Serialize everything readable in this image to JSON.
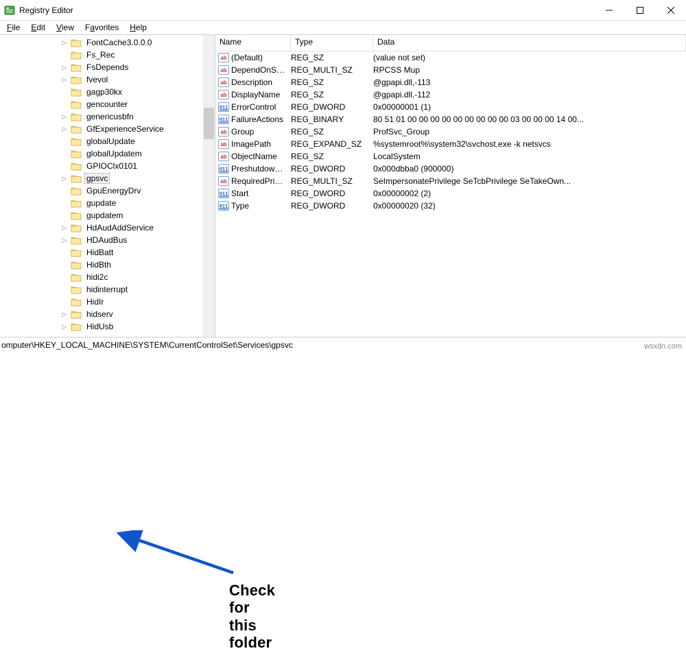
{
  "window": {
    "title": "Registry Editor"
  },
  "menu": {
    "items": [
      "File",
      "Edit",
      "View",
      "Favorites",
      "Help"
    ]
  },
  "tree": {
    "items": [
      {
        "label": "FontCache3.0.0.0",
        "exp": ">"
      },
      {
        "label": "Fs_Rec",
        "exp": ""
      },
      {
        "label": "FsDepends",
        "exp": ">"
      },
      {
        "label": "fvevol",
        "exp": ">"
      },
      {
        "label": "gagp30kx",
        "exp": ""
      },
      {
        "label": "gencounter",
        "exp": ""
      },
      {
        "label": "genericusbfn",
        "exp": ">"
      },
      {
        "label": "GfExperienceService",
        "exp": ">"
      },
      {
        "label": "globalUpdate",
        "exp": ""
      },
      {
        "label": "globalUpdatem",
        "exp": ""
      },
      {
        "label": "GPIOClx0101",
        "exp": ""
      },
      {
        "label": "gpsvc",
        "exp": ">",
        "selected": true
      },
      {
        "label": "GpuEnergyDrv",
        "exp": ""
      },
      {
        "label": "gupdate",
        "exp": ""
      },
      {
        "label": "gupdatem",
        "exp": ""
      },
      {
        "label": "HdAudAddService",
        "exp": ">"
      },
      {
        "label": "HDAudBus",
        "exp": ">"
      },
      {
        "label": "HidBatt",
        "exp": ""
      },
      {
        "label": "HidBth",
        "exp": ""
      },
      {
        "label": "hidi2c",
        "exp": ""
      },
      {
        "label": "hidinterrupt",
        "exp": ""
      },
      {
        "label": "HidIr",
        "exp": ""
      },
      {
        "label": "hidserv",
        "exp": ">"
      },
      {
        "label": "HidUsb",
        "exp": ">"
      }
    ]
  },
  "list": {
    "headers": {
      "name": "Name",
      "type": "Type",
      "data": "Data"
    },
    "rows": [
      {
        "icon": "ab",
        "name": "(Default)",
        "type": "REG_SZ",
        "data": "(value not set)"
      },
      {
        "icon": "ab",
        "name": "DependOnService",
        "type": "REG_MULTI_SZ",
        "data": "RPCSS Mup"
      },
      {
        "icon": "ab",
        "name": "Description",
        "type": "REG_SZ",
        "data": "@gpapi.dll,-113"
      },
      {
        "icon": "ab",
        "name": "DisplayName",
        "type": "REG_SZ",
        "data": "@gpapi.dll,-112"
      },
      {
        "icon": "01",
        "name": "ErrorControl",
        "type": "REG_DWORD",
        "data": "0x00000001 (1)"
      },
      {
        "icon": "01",
        "name": "FailureActions",
        "type": "REG_BINARY",
        "data": "80 51 01 00 00 00 00 00 00 00 00 00 03 00 00 00 14 00..."
      },
      {
        "icon": "ab",
        "name": "Group",
        "type": "REG_SZ",
        "data": "ProfSvc_Group"
      },
      {
        "icon": "ab",
        "name": "ImagePath",
        "type": "REG_EXPAND_SZ",
        "data": "%systemroot%\\system32\\svchost.exe -k netsvcs"
      },
      {
        "icon": "ab",
        "name": "ObjectName",
        "type": "REG_SZ",
        "data": "LocalSystem"
      },
      {
        "icon": "01",
        "name": "PreshutdownTi...",
        "type": "REG_DWORD",
        "data": "0x000dbba0 (900000)"
      },
      {
        "icon": "ab",
        "name": "RequiredPrivileg...",
        "type": "REG_MULTI_SZ",
        "data": "SeImpersonatePrivilege SeTcbPrivilege SeTakeOwn..."
      },
      {
        "icon": "01",
        "name": "Start",
        "type": "REG_DWORD",
        "data": "0x00000002 (2)"
      },
      {
        "icon": "01",
        "name": "Type",
        "type": "REG_DWORD",
        "data": "0x00000020 (32)"
      }
    ]
  },
  "statusbar": {
    "path": "omputer\\HKEY_LOCAL_MACHINE\\SYSTEM\\CurrentControlSet\\Services\\gpsvc"
  },
  "annotation": {
    "text_line1": "Check for this",
    "text_line2": "folder"
  },
  "watermark": "wsxdn.com"
}
